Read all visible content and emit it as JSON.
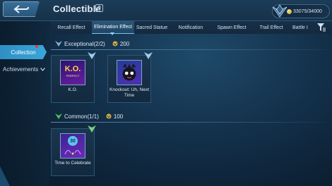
{
  "header": {
    "title": "Collectible",
    "help_glyph": "?",
    "points": "33075/34000"
  },
  "sidebar": {
    "collection_label": "Collection",
    "achievements_label": "Achievements"
  },
  "tabs": [
    {
      "label": "Recall Effect"
    },
    {
      "label": "Elimination Effect"
    },
    {
      "label": "Sacred Statue"
    },
    {
      "label": "Notification"
    },
    {
      "label": "Spawn Effect"
    },
    {
      "label": "Trail Effect"
    },
    {
      "label": "Battle I"
    }
  ],
  "sections": [
    {
      "label": "Exceptional(2/2)",
      "points": "200",
      "items": [
        {
          "caption": "K.O.",
          "art_text": "K.O.",
          "art_sub": "PERFECT"
        },
        {
          "caption": "Knockout: Uh, Next Time"
        }
      ]
    },
    {
      "label": "Common(1/1)",
      "points": "100",
      "items": [
        {
          "caption": "Time to Celebrate",
          "art_text": "30"
        }
      ]
    }
  ],
  "colors": {
    "accent": "#3aa6d9",
    "rank_green": "#54c25a",
    "coin_gold": "#d8b24a"
  },
  "icons": [
    "back-arrow-icon",
    "help-icon",
    "rank-emblem-icon",
    "coin-icon",
    "filter-icon",
    "chevron-down-icon"
  ]
}
